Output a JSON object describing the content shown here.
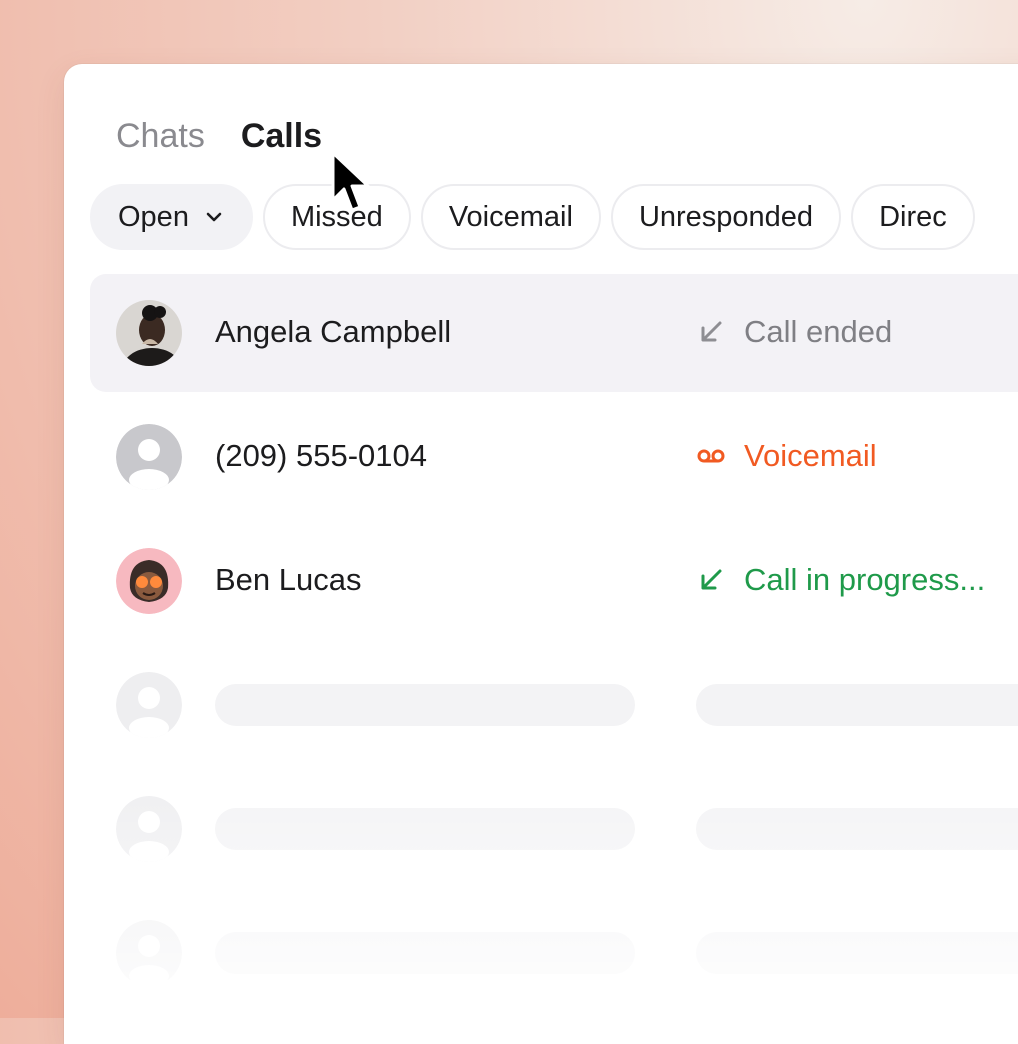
{
  "tabs": [
    {
      "label": "Chats",
      "active": false
    },
    {
      "label": "Calls",
      "active": true
    }
  ],
  "filters": [
    {
      "label": "Open",
      "selected": true,
      "icon": "chevron-down-icon"
    },
    {
      "label": "Missed",
      "selected": false
    },
    {
      "label": "Voicemail",
      "selected": false
    },
    {
      "label": "Unresponded",
      "selected": false
    },
    {
      "label": "Direc",
      "selected": false
    }
  ],
  "calls": [
    {
      "name": "Angela Campbell",
      "status": "Call ended",
      "status_icon": "incoming-arrow-icon",
      "status_color": "#7f7f84",
      "avatar": "photo-avatar"
    },
    {
      "name": "(209) 555-0104",
      "status": "Voicemail",
      "status_icon": "voicemail-icon",
      "status_color": "#f15a22",
      "avatar": "placeholder-avatar"
    },
    {
      "name": "Ben Lucas",
      "status": "Call in progress...",
      "status_icon": "incoming-arrow-icon",
      "status_color": "#1f9a4a",
      "avatar": "emoji-avatar"
    }
  ],
  "colors": {
    "highlight_row": "#f3f2f6",
    "voicemail": "#f15a22",
    "in_progress": "#1f9a4a",
    "ended": "#7f7f84"
  }
}
